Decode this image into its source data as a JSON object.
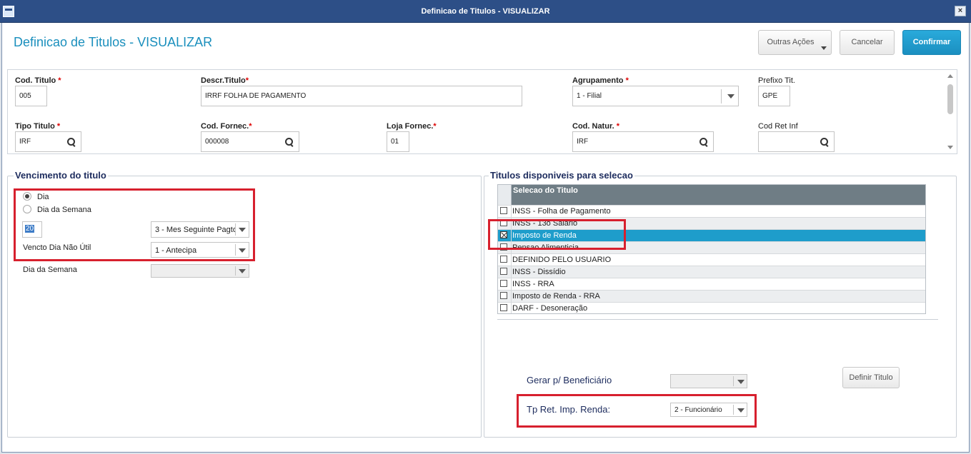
{
  "window": {
    "title": "Definicao de Titulos - VISUALIZAR",
    "close_label": "×"
  },
  "page_title": "Definicao de Titulos - VISUALIZAR",
  "toolbar": {
    "outras_label": "Outras Ações",
    "cancel_label": "Cancelar",
    "confirm_label": "Confirmar"
  },
  "form": {
    "cod_titulo": {
      "label": "Cod. Titulo",
      "value": "005"
    },
    "descr_titulo": {
      "label": "Descr.Titulo",
      "value": "IRRF FOLHA DE PAGAMENTO"
    },
    "agrupamento": {
      "label": "Agrupamento",
      "value": "1 - Filial"
    },
    "prefixo": {
      "label": "Prefixo Tit.",
      "value": "GPE"
    },
    "tipo_titulo": {
      "label": "Tipo Titulo",
      "value": "IRF"
    },
    "cod_fornec": {
      "label": "Cod. Fornec.",
      "value": "000008"
    },
    "loja_fornec": {
      "label": "Loja Fornec.",
      "value": "01"
    },
    "cod_natur": {
      "label": "Cod. Natur.",
      "value": "IRF"
    },
    "cod_ret": {
      "label": "Cod Ret Inf",
      "value": ""
    },
    "required_mark": "*"
  },
  "vencimento": {
    "title": "Vencimento do titulo",
    "radio_dia": "Dia",
    "radio_semana": "Dia da Semana",
    "dia_value": "20",
    "mes_select": "3 - Mes Seguinte Pagto",
    "vencto_label": "Vencto Dia Não Útil",
    "vencto_select": "1 - Antecipa",
    "dia_semana_label": "Dia da Semana",
    "dia_semana_select": ""
  },
  "titulos": {
    "title": "Titulos disponiveis para selecao",
    "column": "Selecao do Titulo",
    "rows": [
      {
        "label": "INSS - Folha de Pagamento",
        "checked": false
      },
      {
        "label": "INSS - 13o Salario",
        "checked": false
      },
      {
        "label": "Imposto de Renda",
        "checked": true
      },
      {
        "label": "Pensao Alimenticia",
        "checked": false
      },
      {
        "label": "DEFINIDO PELO USUARIO",
        "checked": false
      },
      {
        "label": "INSS - Dissídio",
        "checked": false
      },
      {
        "label": "INSS - RRA",
        "checked": false
      },
      {
        "label": "Imposto de Renda - RRA",
        "checked": false
      },
      {
        "label": "DARF - Desoneração",
        "checked": false
      }
    ],
    "gerar_label": "Gerar p/ Beneficiário",
    "gerar_value": "",
    "definir_label": "Definir Titulo",
    "tp_ret_label": "Tp Ret. Imp. Renda:",
    "tp_ret_value": "2 - Funcionário"
  },
  "colors": {
    "accent": "#1a8fbd",
    "highlight": "#d7202e",
    "selected_row": "#1e9dcb"
  }
}
